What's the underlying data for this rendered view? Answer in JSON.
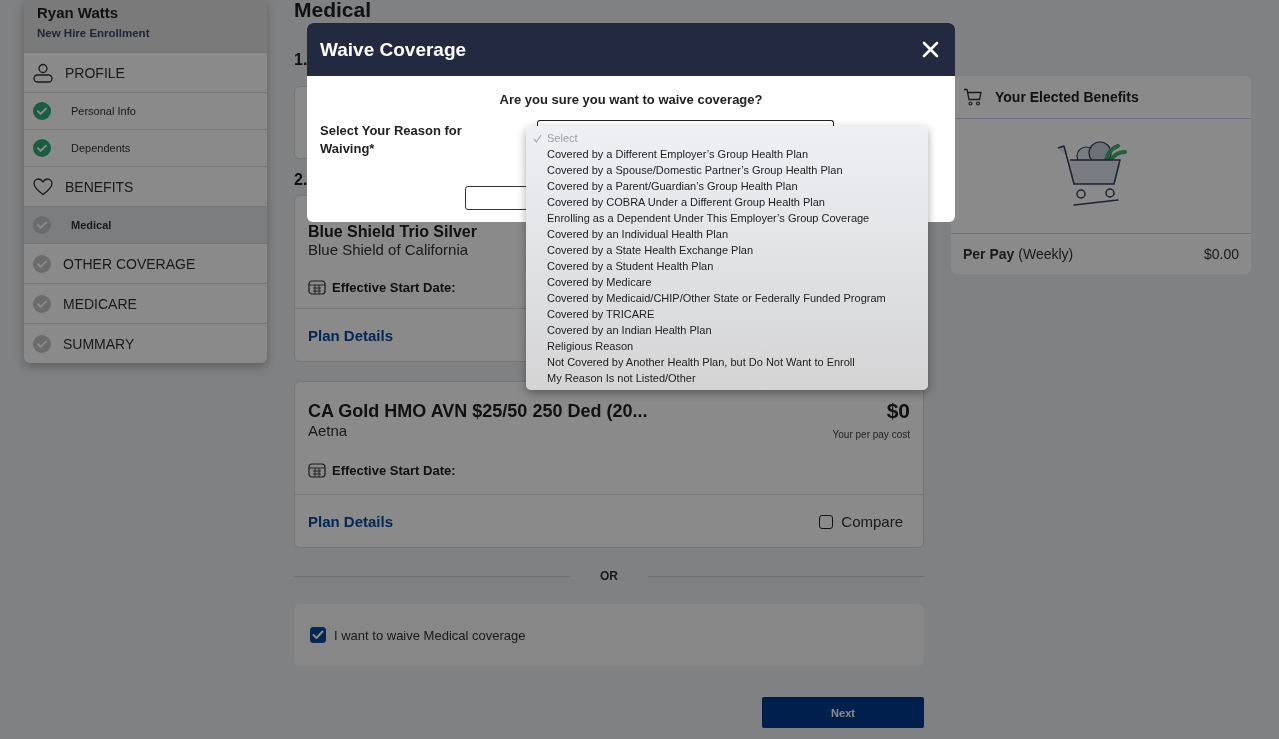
{
  "sidebar": {
    "name": "Ryan Watts",
    "subtitle": "New Hire Enrollment",
    "items": [
      {
        "kind": "profile",
        "label": "PROFILE",
        "selected": false
      },
      {
        "kind": "step",
        "label": "Personal Info",
        "completed": true,
        "selected": false
      },
      {
        "kind": "step",
        "label": "Dependents",
        "completed": true,
        "selected": false
      },
      {
        "kind": "benefits",
        "label": "BENEFITS",
        "selected": false
      },
      {
        "kind": "step",
        "label": "Medical",
        "completed": false,
        "selected": true
      },
      {
        "kind": "section",
        "label": "OTHER COVERAGE",
        "completed": false,
        "selected": false
      },
      {
        "kind": "section",
        "label": "MEDICARE",
        "completed": false,
        "selected": false
      },
      {
        "kind": "section",
        "label": "SUMMARY",
        "completed": false,
        "selected": false
      }
    ]
  },
  "main": {
    "heading": "Medical",
    "steps": [
      "1.",
      "2."
    ],
    "plans": [
      {
        "title": "Blue Shield Trio Silver",
        "carrier": "Blue Shield of California",
        "date_label": "Effective Start Date:",
        "details_link": "Plan Details"
      },
      {
        "title": "CA Gold HMO AVN $25/50 250 Ded (20...",
        "carrier": "Aetna",
        "price": "$0",
        "price_note": "Your per pay cost",
        "date_label": "Effective Start Date:",
        "details_link": "Plan Details",
        "compare": {
          "label": "Compare",
          "checked": false
        }
      }
    ],
    "divider_text": "OR",
    "waive": {
      "label": "I want to waive Medical coverage",
      "checked": true
    },
    "next_button": "Next"
  },
  "elected": {
    "title": "Your Elected Benefits",
    "per_pay": "**Per Pay** (Weekly)",
    "amount": "$0.00"
  },
  "modal": {
    "title": "Waive Coverage",
    "question": "Are you sure you want to waive coverage?",
    "field_label": "Select Your Reason for Waiving*",
    "options": [
      {
        "label": "Select",
        "selected": true,
        "disabled": true
      },
      {
        "label": "Covered by a Different Employer’s Group Health Plan",
        "selected": false,
        "disabled": false
      },
      {
        "label": "Covered by a Spouse/Domestic Partner’s Group Health Plan",
        "selected": false,
        "disabled": false
      },
      {
        "label": "Covered by a Parent/Guardian’s Group Health Plan",
        "selected": false,
        "disabled": false
      },
      {
        "label": "Covered by COBRA Under a Different Group Health Plan",
        "selected": false,
        "disabled": false
      },
      {
        "label": "Enrolling as a Dependent Under This Employer’s Group Coverage",
        "selected": false,
        "disabled": false
      },
      {
        "label": "Covered by an Individual Health Plan",
        "selected": false,
        "disabled": false
      },
      {
        "label": "Covered by a State Health Exchange Plan",
        "selected": false,
        "disabled": false
      },
      {
        "label": "Covered by a Student Health Plan",
        "selected": false,
        "disabled": false
      },
      {
        "label": "Covered by Medicare",
        "selected": false,
        "disabled": false
      },
      {
        "label": "Covered by Medicaid/CHIP/Other State or Federally Funded Program",
        "selected": false,
        "disabled": false
      },
      {
        "label": "Covered by TRICARE",
        "selected": false,
        "disabled": false
      },
      {
        "label": "Covered by an Indian Health Plan",
        "selected": false,
        "disabled": false
      },
      {
        "label": "Religious Reason",
        "selected": false,
        "disabled": false
      },
      {
        "label": "Not Covered by Another Health Plan, but Do Not Want to Enroll",
        "selected": false,
        "disabled": false
      },
      {
        "label": "My Reason Is not Listed/Other",
        "selected": false,
        "disabled": false
      }
    ]
  }
}
